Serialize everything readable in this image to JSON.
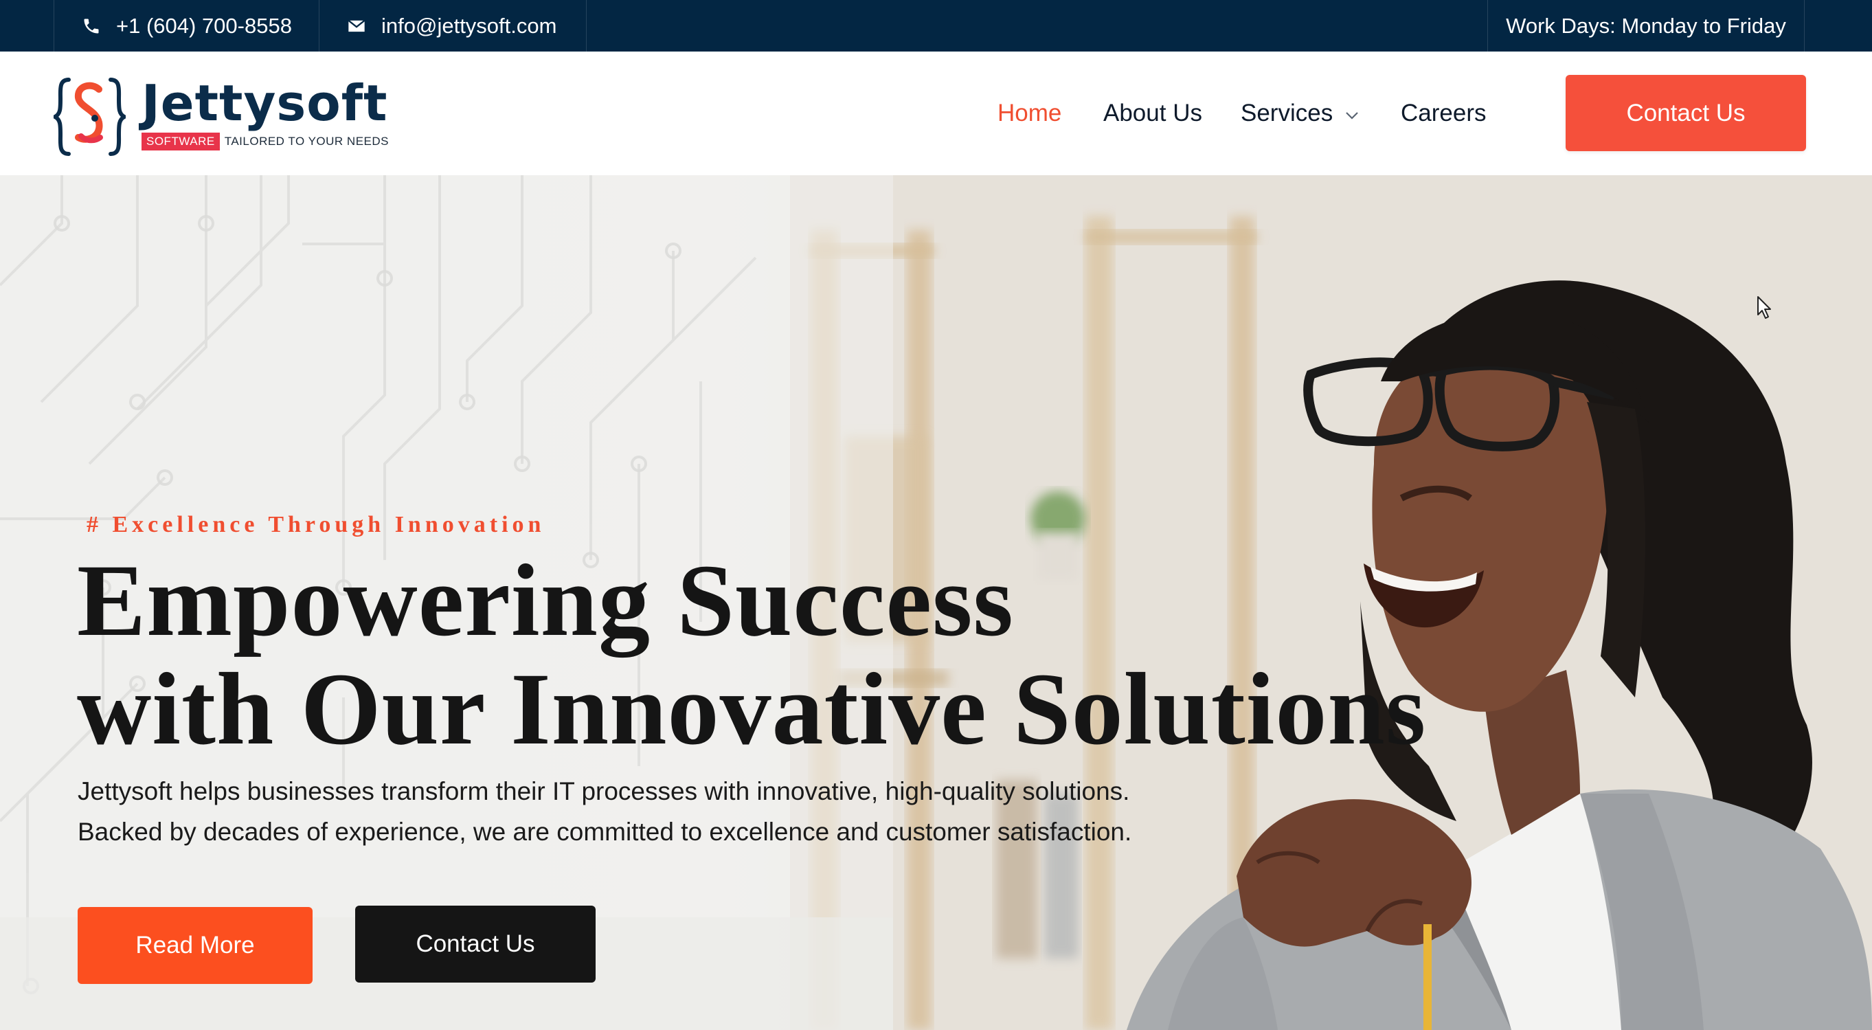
{
  "topbar": {
    "phone": "+1 (604) 700-8558",
    "email": "info@jettysoft.com",
    "workdays": "Work Days: Monday to Friday",
    "phone_icon": "phone-icon",
    "email_icon": "envelope-icon"
  },
  "header": {
    "logo": {
      "wordmark": "Jettysoft",
      "tag_highlight": "SOFTWARE",
      "tag_rest": "TAILORED TO YOUR NEEDS"
    },
    "nav": {
      "home": "Home",
      "about": "About Us",
      "services": "Services",
      "careers": "Careers",
      "active": "Home"
    },
    "cta": "Contact Us"
  },
  "hero": {
    "eyebrow": "# Excellence Through Innovation",
    "headline_line1": "Empowering Success",
    "headline_line2": "with Our Innovative Solutions",
    "desc_line1": "Jettysoft helps businesses transform their IT processes with innovative, high-quality solutions.",
    "desc_line2": "Backed by decades of experience, we are committed to excellence and customer satisfaction.",
    "read_more": "Read More",
    "contact": "Contact Us"
  },
  "colors": {
    "topbar_bg": "#032643",
    "accent": "#f5503b",
    "read_more": "#fc4f1f",
    "dark_button": "#151515",
    "heading": "#151515"
  }
}
